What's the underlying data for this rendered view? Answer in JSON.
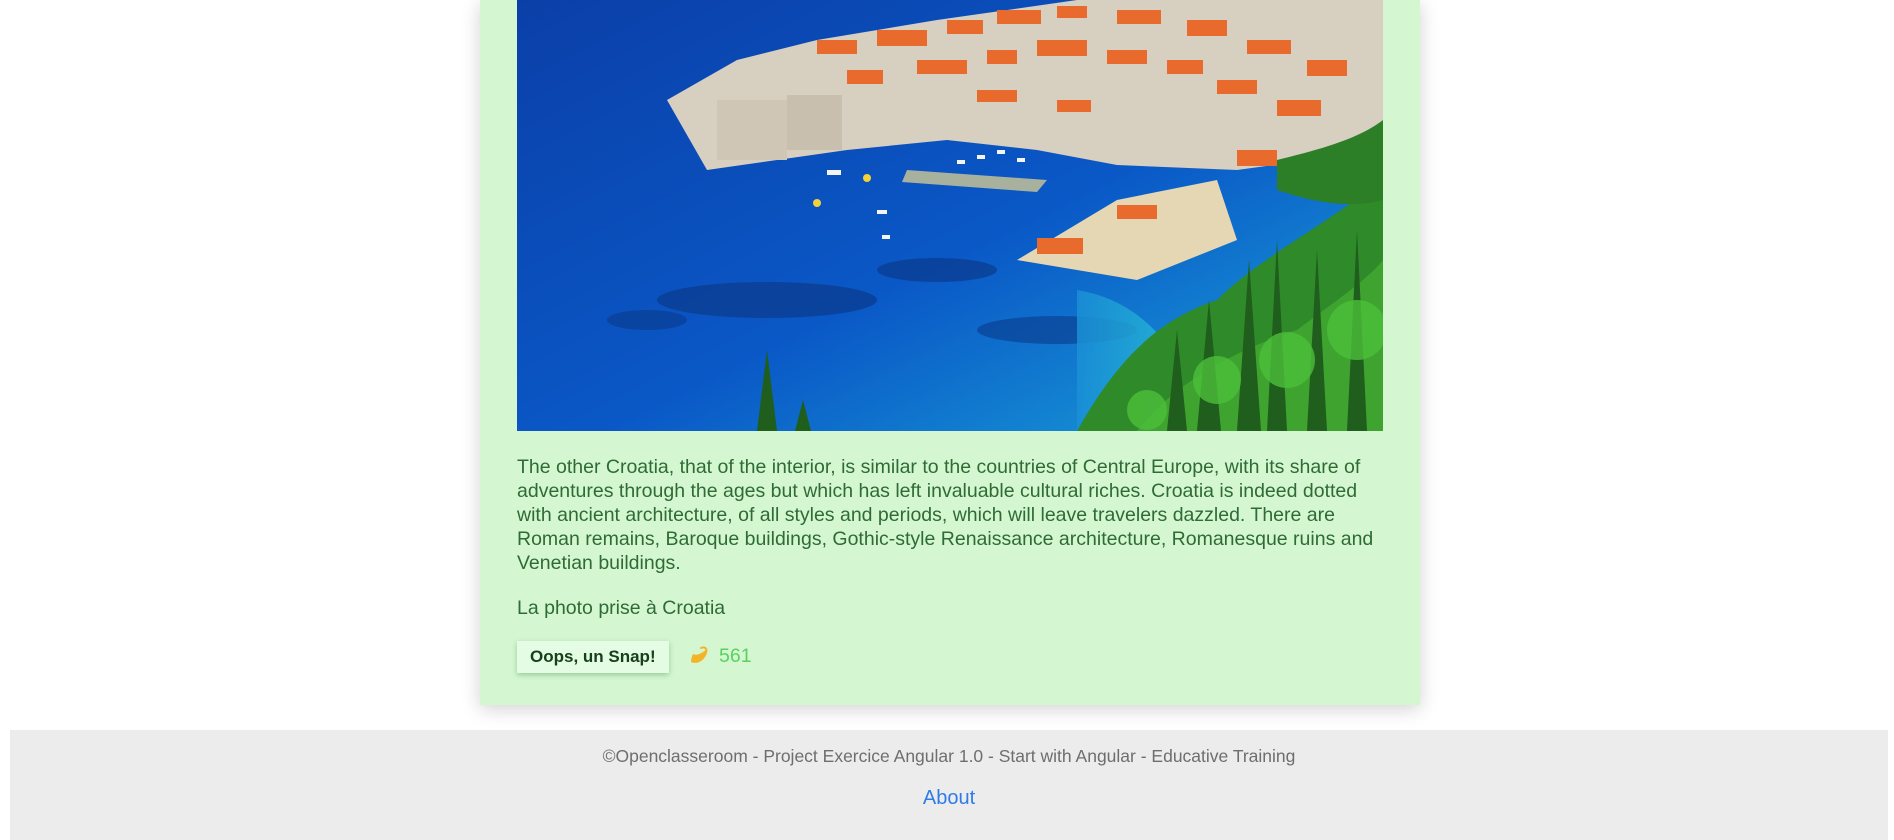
{
  "card": {
    "photo_alt": "Croatia",
    "description": "The other Croatia, that of the interior, is similar to the countries of Central Europe, with its share of adventures through the ages but which has left invaluable cultural riches. Croatia is indeed dotted with ancient architecture, of all styles and periods, which will leave travelers dazzled. There are Roman remains, Baroque buildings, Gothic-style Renaissance architecture, Romanesque ruins and Venetian buildings.",
    "location": "La photo prise à Croatia",
    "snap_button_label": "Oops, un Snap!",
    "snap_icon": "hand-snap-icon",
    "snap_count": "561"
  },
  "footer": {
    "copyright": "©Openclasseroom - Project Exercice Angular 1.0 - Start with Angular - Educative Training",
    "about_link": "About"
  },
  "colors": {
    "card_background": "#d4f7d2",
    "text_green": "#2f6b35",
    "snap_count_green": "#59d15f",
    "footer_background": "#ececec",
    "link_blue": "#2d7ce8"
  }
}
